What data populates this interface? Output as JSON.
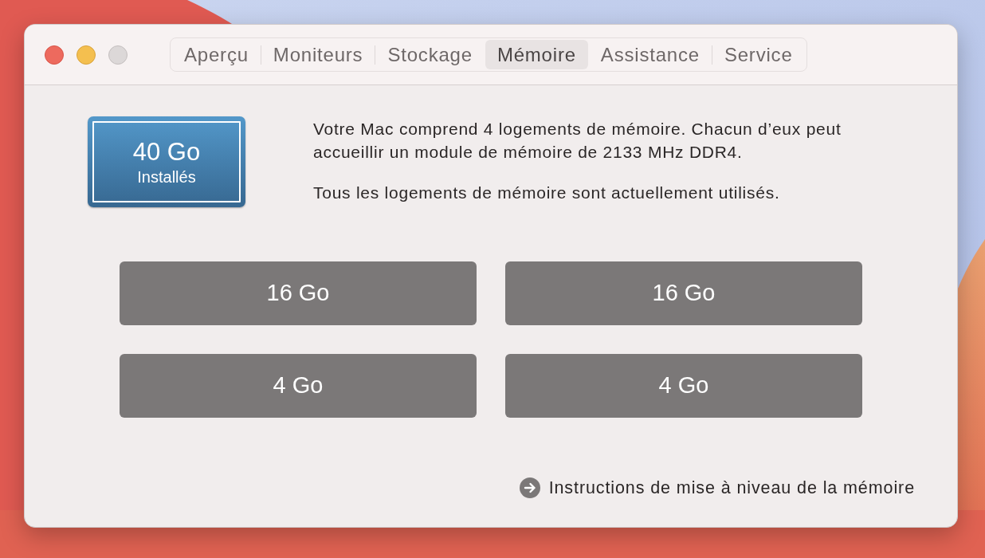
{
  "window_buttons": [
    {
      "kind": "close",
      "disabled": false
    },
    {
      "kind": "minimize",
      "disabled": false
    },
    {
      "kind": "zoom",
      "disabled": true
    }
  ],
  "tabs": [
    {
      "label": "Aperçu",
      "selected": false
    },
    {
      "label": "Moniteurs",
      "selected": false
    },
    {
      "label": "Stockage",
      "selected": false
    },
    {
      "label": "Mémoire",
      "selected": true
    },
    {
      "label": "Assistance",
      "selected": false
    },
    {
      "label": "Service",
      "selected": false
    }
  ],
  "memory_total": {
    "amount": "40 Go",
    "label": "Installés"
  },
  "description": [
    "Votre Mac comprend 4 logements de mémoire. Chacun d’eux peut accueillir un module de mémoire de 2133 MHz DDR4.",
    "Tous les logements de mémoire sont actuellement utilisés."
  ],
  "slots": [
    {
      "label": "16 Go"
    },
    {
      "label": "16 Go"
    },
    {
      "label": "4 Go"
    },
    {
      "label": "4 Go"
    }
  ],
  "upgrade_link": {
    "label": "Instructions de mise à niveau de la mémoire"
  }
}
